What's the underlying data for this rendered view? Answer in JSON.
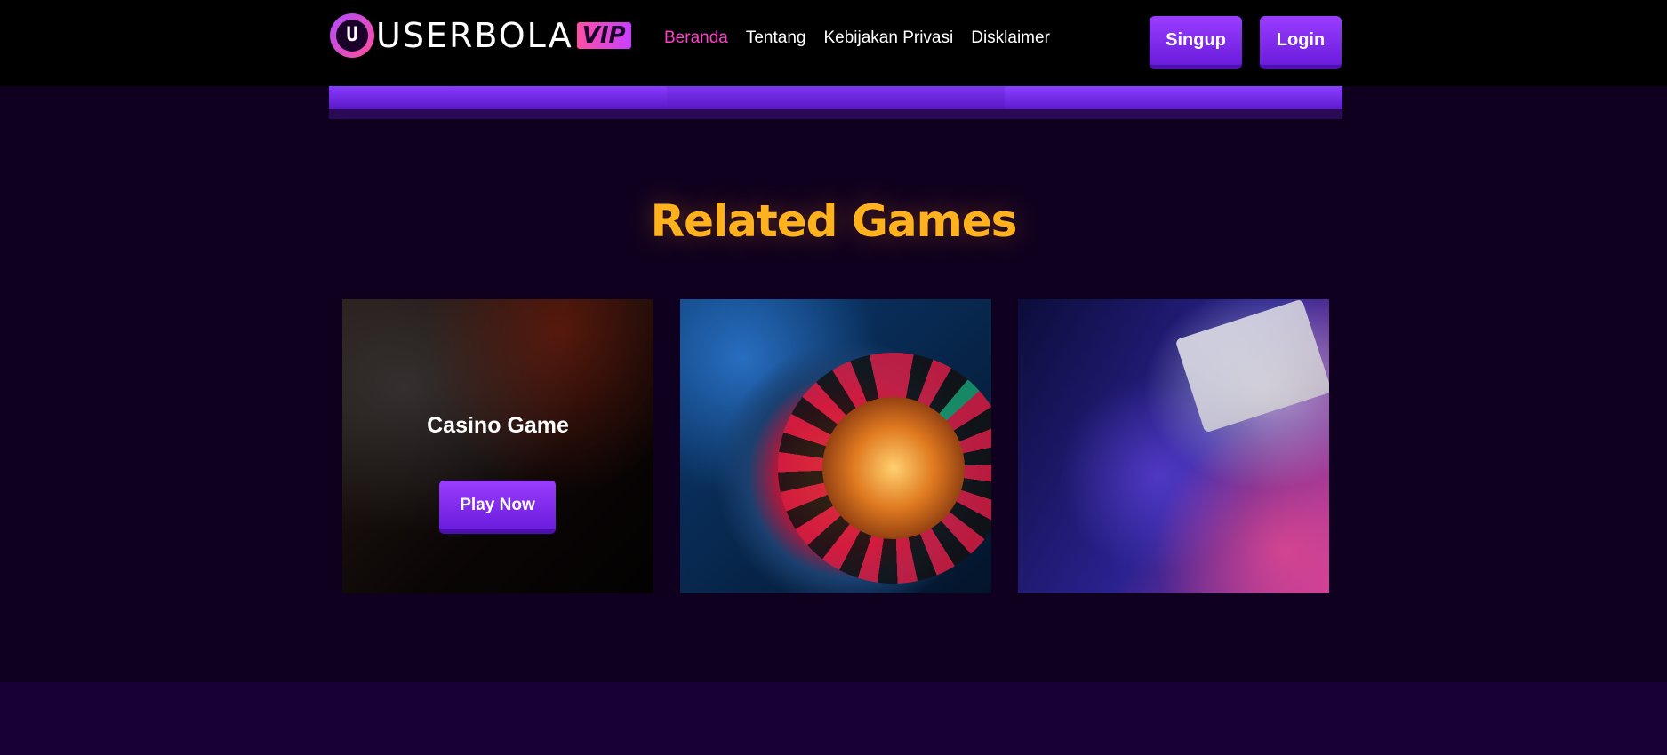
{
  "header": {
    "logo_text": "USERBOLA",
    "logo_badge": "VIP",
    "logo_mark": "U",
    "nav": [
      {
        "label": "Beranda",
        "active": true
      },
      {
        "label": "Tentang",
        "active": false
      },
      {
        "label": "Kebijakan Privasi",
        "active": false
      },
      {
        "label": "Disklaimer",
        "active": false
      }
    ],
    "signup_label": "Singup",
    "login_label": "Login"
  },
  "section": {
    "title": "Related Games"
  },
  "cards": [
    {
      "title": "Casino Game",
      "button": "Play Now",
      "image": "slot-machine-image"
    },
    {
      "image": "roulette-wheel-image"
    },
    {
      "image": "poker-cards-image"
    }
  ],
  "colors": {
    "accent_purple": "#7b2cf0",
    "title_orange": "#ffb21e",
    "nav_active_pink": "#ff3fc8",
    "background": "#0f001f"
  }
}
